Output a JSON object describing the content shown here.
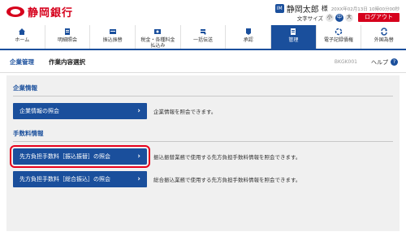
{
  "header": {
    "bank_name": "静岡銀行",
    "user_icon": "IM",
    "user_name": "静岡太郎",
    "user_suffix": "様",
    "login_time": "20XX年02月13日 10時00分00秒",
    "fontsize_label": "文字サイズ",
    "fontsize_options": [
      "小",
      "中",
      "大"
    ],
    "logout_label": "ログアウト"
  },
  "nav": {
    "items": [
      {
        "label": "ホーム",
        "icon": "home-icon"
      },
      {
        "label": "明細照会",
        "icon": "document-icon"
      },
      {
        "label": "振込振替",
        "icon": "transfer-icon"
      },
      {
        "label": "税金・各種料金\n払込み",
        "icon": "tax-icon"
      },
      {
        "label": "一括伝送",
        "icon": "bulk-icon"
      },
      {
        "label": "承認",
        "icon": "approval-icon"
      },
      {
        "label": "管理",
        "icon": "manage-icon"
      },
      {
        "label": "電子記録債権",
        "icon": "erecord-icon"
      },
      {
        "label": "外国為替",
        "icon": "forex-icon"
      }
    ]
  },
  "title_bar": {
    "crumb": "企業管理",
    "title": "作業内容選択",
    "code": "BKGK001",
    "help": "ヘルプ"
  },
  "sections": [
    {
      "title": "企業情報",
      "rows": [
        {
          "button": "企業情報の照会",
          "desc": "企業情報を照会できます。"
        }
      ]
    },
    {
      "title": "手数料情報",
      "rows": [
        {
          "button": "先方負担手数料［振込振替］の照会",
          "desc": "振込振替業務で使用する先方負担手数料情報を照会できます。"
        },
        {
          "button": "先方負担手数料［総合振込］の照会",
          "desc": "総合振込業務で使用する先方負担手数料情報を照会できます。"
        }
      ]
    }
  ],
  "colors": {
    "brand_red": "#d6001c",
    "nav_blue": "#1a4f9c",
    "highlight_red": "#e8001c"
  }
}
